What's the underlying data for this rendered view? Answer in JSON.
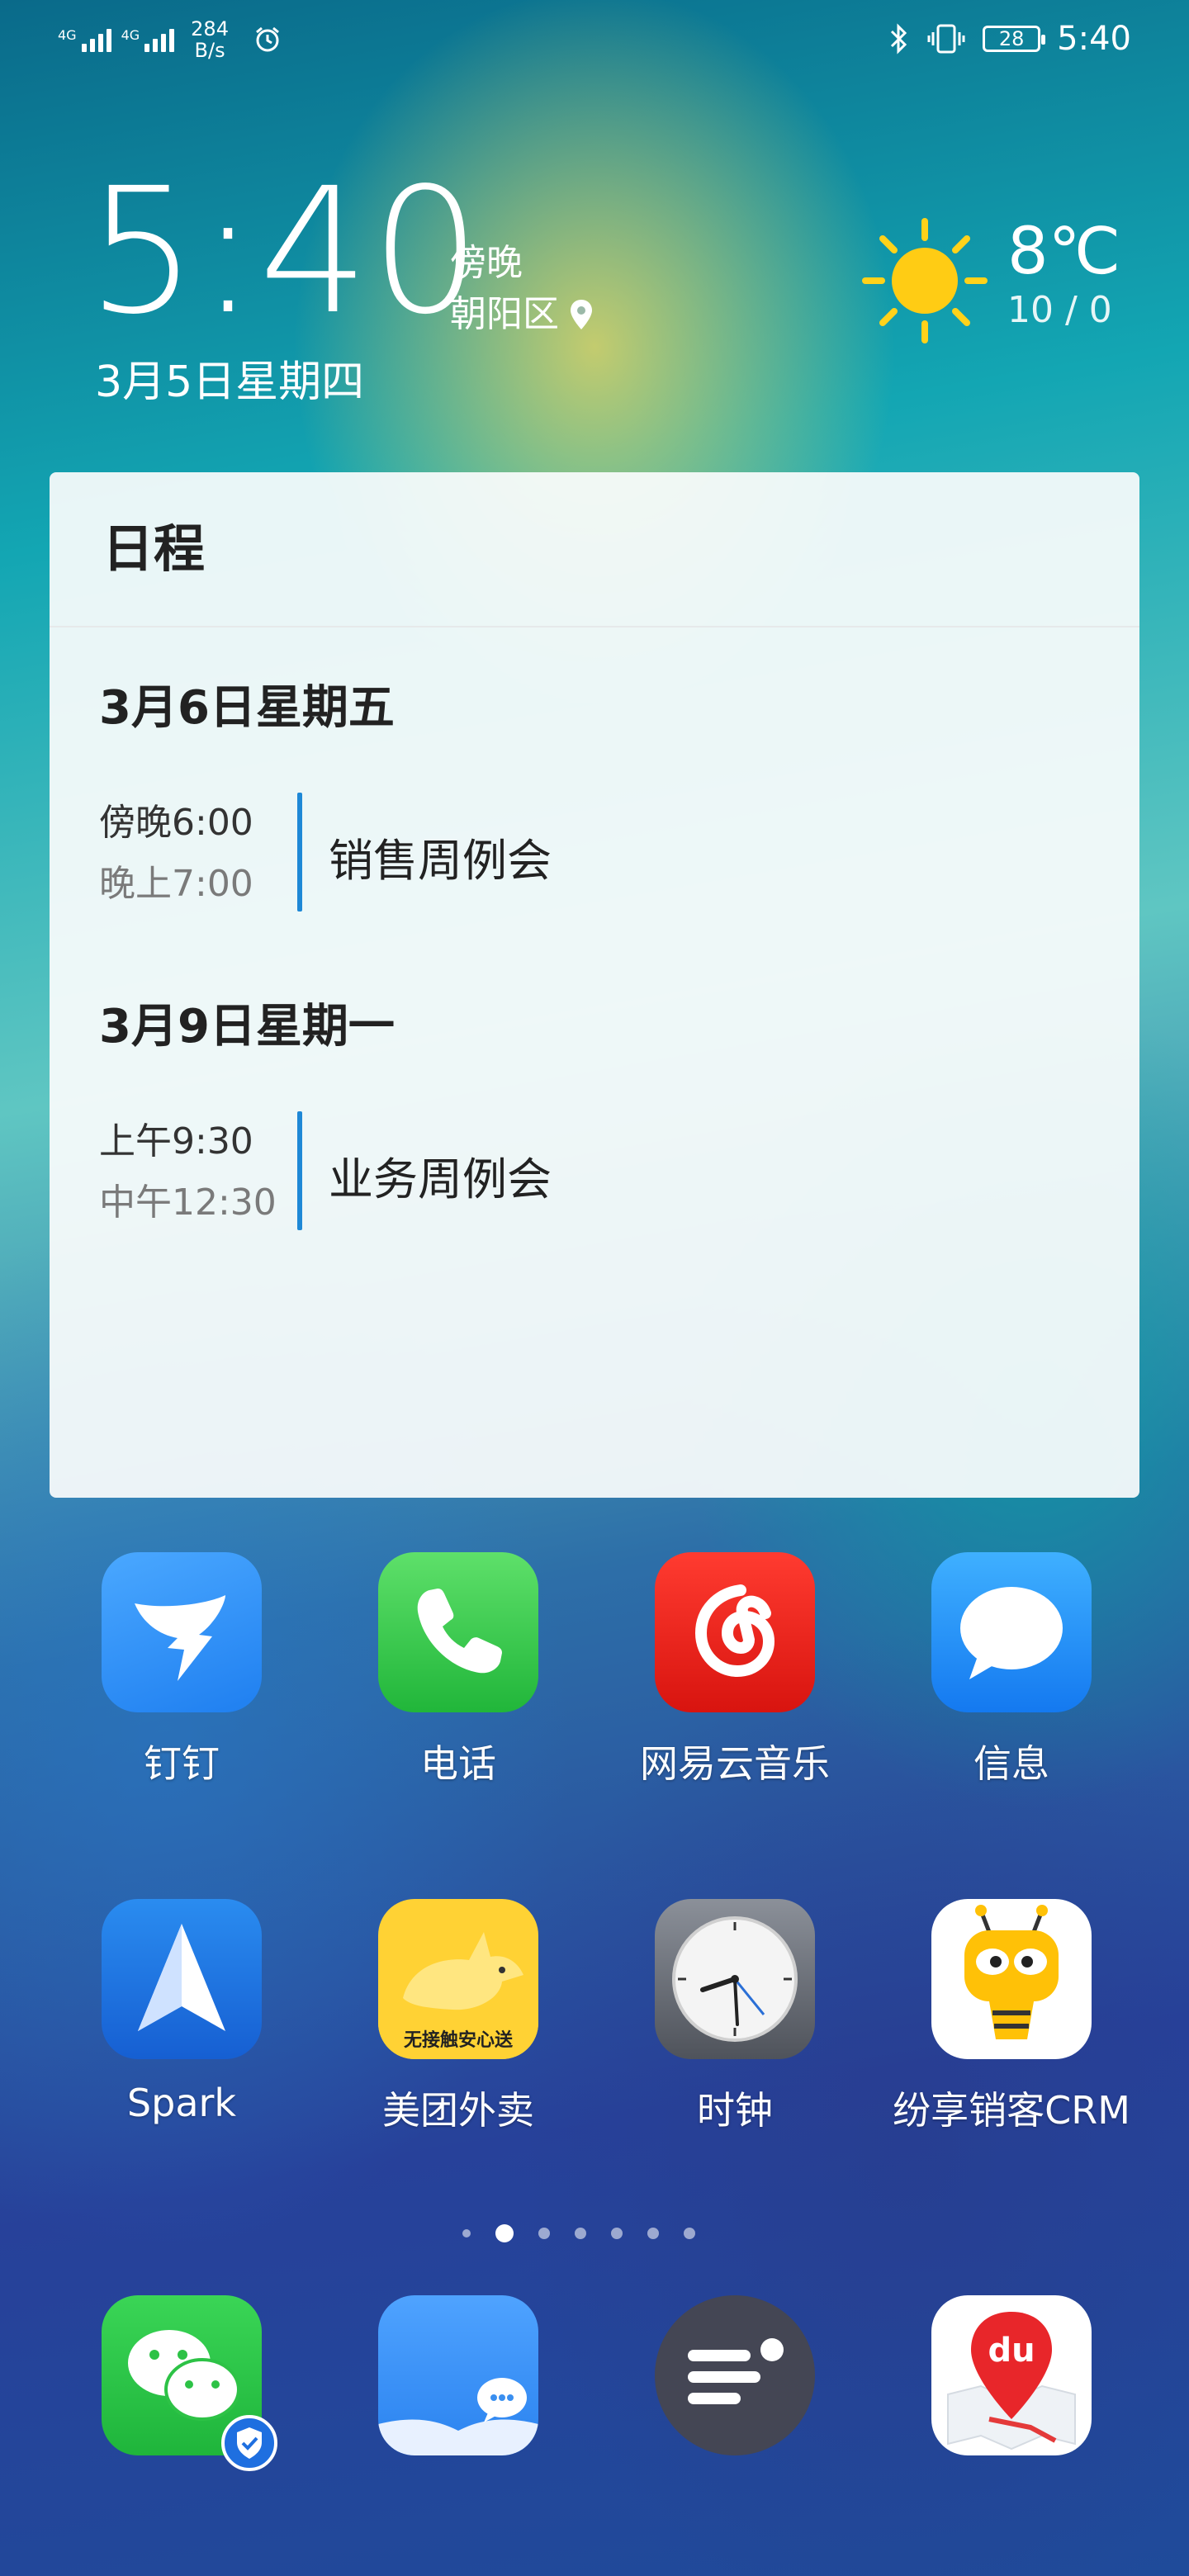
{
  "status_bar": {
    "net1": "4G",
    "net2": "4G",
    "speed_value": "284",
    "speed_unit": "B/s",
    "battery": "28",
    "time": "5:40"
  },
  "clock_widget": {
    "time": "5:40",
    "period": "傍晚",
    "location": "朝阳区",
    "date": "3月5日星期四"
  },
  "weather": {
    "icon": "sun-icon",
    "temp": "8℃",
    "range": "10 / 0"
  },
  "schedule": {
    "title": "日程",
    "days": [
      {
        "date": "3月6日星期五",
        "events": [
          {
            "start": "傍晚6:00",
            "end": "晚上7:00",
            "title": "销售周例会"
          }
        ]
      },
      {
        "date": "3月9日星期一",
        "events": [
          {
            "start": "上午9:30",
            "end": "中午12:30",
            "title": "业务周例会"
          }
        ]
      }
    ]
  },
  "apps": [
    {
      "label": "钉钉",
      "icon": "dingtalk-icon",
      "color": "#3296fa"
    },
    {
      "label": "电话",
      "icon": "phone-icon",
      "color": "#2fc84a"
    },
    {
      "label": "网易云音乐",
      "icon": "netease-music-icon",
      "color": "#e8201d"
    },
    {
      "label": "信息",
      "icon": "message-icon",
      "color": "#1a8df5"
    },
    {
      "label": "Spark",
      "icon": "spark-icon",
      "color": "#1c6fe0"
    },
    {
      "label": "美团外卖",
      "icon": "meituan-waimai-icon",
      "color": "#ffd234"
    },
    {
      "label": "时钟",
      "icon": "clock-icon",
      "color": "#6b6f78"
    },
    {
      "label": "纷享销客CRM",
      "icon": "fxiaoke-crm-icon",
      "color": "#ffffff"
    }
  ],
  "meituan_badge": "无接触安心送",
  "baidu_map_text": "du",
  "page_indicator": {
    "pages": 7,
    "current": 2
  },
  "dock": [
    {
      "icon": "wechat-icon",
      "color": "#2dc246"
    },
    {
      "icon": "chat-book-icon",
      "color": "#3a8ff0"
    },
    {
      "icon": "menu-app-icon",
      "color": "#444654"
    },
    {
      "icon": "baidu-map-icon",
      "color": "#ffffff"
    }
  ]
}
